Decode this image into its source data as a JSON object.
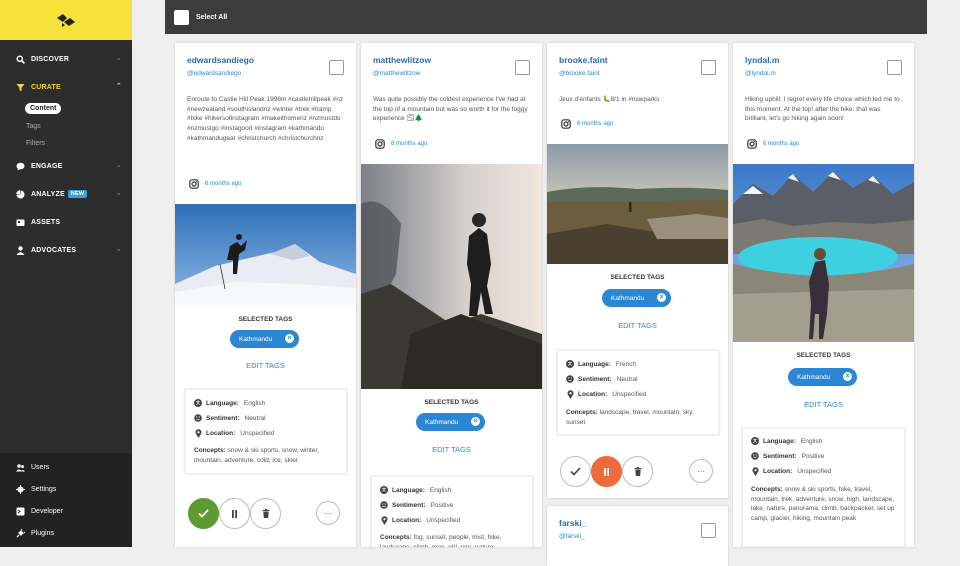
{
  "sidebar": {
    "logo": "brand-logo",
    "items": [
      {
        "label": "DISCOVER",
        "icon": "search-icon"
      },
      {
        "label": "CURATE",
        "icon": "filter-icon"
      },
      {
        "label": "ENGAGE",
        "icon": "chat-icon"
      },
      {
        "label": "ANALYZE",
        "icon": "pie-chart-icon",
        "badge": "NEW"
      },
      {
        "label": "ASSETS",
        "icon": "assets-icon"
      },
      {
        "label": "ADVOCATES",
        "icon": "person-icon"
      }
    ],
    "curate_sub": [
      "Content",
      "Tags",
      "Filters"
    ],
    "bottom": [
      {
        "label": "Users",
        "icon": "users-icon"
      },
      {
        "label": "Settings",
        "icon": "gear-icon"
      },
      {
        "label": "Developer",
        "icon": "terminal-icon"
      },
      {
        "label": "Plugins",
        "icon": "plug-icon"
      }
    ]
  },
  "topbar": {
    "select_all": "Select All"
  },
  "colors": {
    "brand_yellow": "#f7e23b",
    "link_blue": "#2b8ad0",
    "approve_green": "#5c9b2f",
    "pause_orange": "#ee6a3a"
  },
  "labels": {
    "selected_tags": "SELECTED TAGS",
    "edit_tags": "EDIT TAGS",
    "language": "Language:",
    "sentiment": "Sentiment:",
    "location": "Location:",
    "concepts": "Concepts:",
    "more": "···"
  },
  "cards": [
    {
      "name": "edwardsandiego",
      "handle": "@edwardsandiego",
      "caption": "Enroute to Castle Hill Peak 1998m #castlehillpeak #nz #newzealand #southislandnz #winter #trek #tramp #hike #hikersofinstagram #makeithomenz #nzmustdo #nzmustgo #instagood #instagram #kathmandu #kathmandugear #christchurch #christchurchnz",
      "ago": "6 months ago",
      "tag": "Kathmandu",
      "language": "English",
      "sentiment": "Neutral",
      "location": "Unspecified",
      "concepts": "snow & ski sports, snow, winter, mountain, adventure, cold, ice, skier"
    },
    {
      "name": "matthewlitzow",
      "handle": "@matthewlitzow",
      "caption": "Was quite possibly the coldest experience I've had at the top of a mountain but was so worth it for the foggy experience 🌫🌲",
      "ago": "6 months ago",
      "tag": "Kathmandu",
      "language": "English",
      "sentiment": "Positive",
      "location": "Unspecified",
      "concepts": "fog, sunset, people, mist, hike, landscape, climb, man, girl, one, nature"
    },
    {
      "name": "brooke.faint",
      "handle": "@brooke.faint",
      "caption": "Jeux d'enfants 🐛8/1 in #nswparks",
      "ago": "6 months ago",
      "tag": "Kathmandu",
      "language": "French",
      "sentiment": "Neutral",
      "location": "Unspecified",
      "concepts": "landscape, travel, mountain, sky, sunset"
    },
    {
      "name": "lyndal.m",
      "handle": "@lyndal.m",
      "caption": "Hiking uphill: I regret every life choice which led me to this moment. At the top! after the hike: that was brilliant, let's go hiking again soon!",
      "ago": "6 months ago",
      "tag": "Kathmandu",
      "language": "English",
      "sentiment": "Positive",
      "location": "Unspecified",
      "concepts": "snow & ski sports, hike, travel, mountain, trek, adventure, snow, high, landscape, lake, nature, panorama, climb, backpacker, set up camp, glacier, hiking, mountain peak"
    },
    {
      "name": "farski_",
      "handle": "@farski_"
    }
  ]
}
